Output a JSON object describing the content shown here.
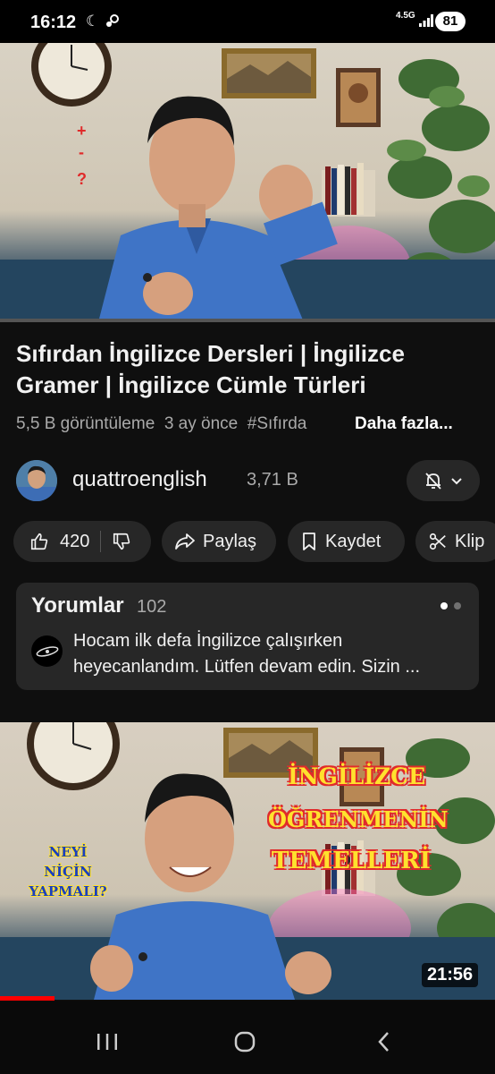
{
  "status_bar": {
    "time": "16:12",
    "network": "4.5G",
    "battery": "81"
  },
  "player": {
    "overlay_text": [
      "+",
      "-",
      "?"
    ],
    "progress_fraction": 0.0
  },
  "video": {
    "title": "Sıfırdan İngilizce Dersleri | İngilizce Gramer | İngilizce Cümle Türleri",
    "views": "5,5 B görüntüleme",
    "age": "3 ay önce",
    "hashtag": "#Sıfırda",
    "more_label": "Daha fazla..."
  },
  "channel": {
    "name": "quattroenglish",
    "subscribers": "3,71 B",
    "notification_icon": "bell-off-icon"
  },
  "actions": {
    "like_count": "420",
    "share_label": "Paylaş",
    "save_label": "Kaydet",
    "clip_label": "Klip"
  },
  "comments": {
    "title": "Yorumlar",
    "count": "102",
    "top_comment": "Hocam ilk defa İngilizce çalışırken heyecanlandım. Lütfen devam edin. Sizin ..."
  },
  "next_video": {
    "overlay_left": "NEYİ NİÇİN YAPMALI?",
    "overlay_right": [
      "İNGİLİZCE",
      "ÖĞRENMENİN",
      "TEMELLERİ"
    ],
    "duration": "21:56",
    "watched_fraction": 0.11
  },
  "colors": {
    "background": "#0f0f0f",
    "chip": "#272727",
    "secondary_text": "#aaaaaa",
    "progress": "#ff0000",
    "overlay_yellow": "#ffe12e",
    "overlay_red": "#e02a2a",
    "overlay_blue": "#1a3fbf"
  }
}
